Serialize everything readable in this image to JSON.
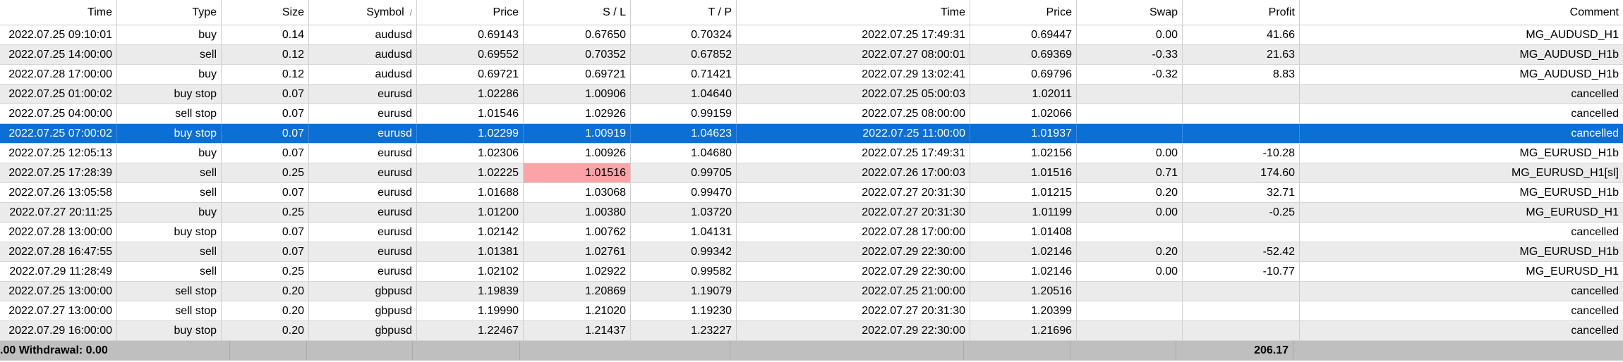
{
  "headers": [
    "Time",
    "Type",
    "Size",
    "Symbol",
    "Price",
    "S / L",
    "T / P",
    "Time",
    "Price",
    "Swap",
    "Profit",
    "Comment"
  ],
  "sort_icon": "/",
  "rows": [
    {
      "open_time": "2022.07.25 09:10:01",
      "type": "buy",
      "size": "0.14",
      "symbol": "audusd",
      "open_price": "0.69143",
      "sl": "0.67650",
      "tp": "0.70324",
      "close_time": "2022.07.25 17:49:31",
      "close_price": "0.69447",
      "swap": "0.00",
      "profit": "41.66",
      "comment": "MG_AUDUSD_H1"
    },
    {
      "open_time": "2022.07.25 14:00:00",
      "type": "sell",
      "size": "0.12",
      "symbol": "audusd",
      "open_price": "0.69552",
      "sl": "0.70352",
      "tp": "0.67852",
      "close_time": "2022.07.27 08:00:01",
      "close_price": "0.69369",
      "swap": "-0.33",
      "profit": "21.63",
      "comment": "MG_AUDUSD_H1b"
    },
    {
      "open_time": "2022.07.28 17:00:00",
      "type": "buy",
      "size": "0.12",
      "symbol": "audusd",
      "open_price": "0.69721",
      "sl": "0.69721",
      "tp": "0.71421",
      "close_time": "2022.07.29 13:02:41",
      "close_price": "0.69796",
      "swap": "-0.32",
      "profit": "8.83",
      "comment": "MG_AUDUSD_H1b"
    },
    {
      "open_time": "2022.07.25 01:00:02",
      "type": "buy stop",
      "size": "0.07",
      "symbol": "eurusd",
      "open_price": "1.02286",
      "sl": "1.00906",
      "tp": "1.04640",
      "close_time": "2022.07.25 05:00:03",
      "close_price": "1.02011",
      "swap": "",
      "profit": "",
      "comment": "cancelled"
    },
    {
      "open_time": "2022.07.25 04:00:00",
      "type": "sell stop",
      "size": "0.07",
      "symbol": "eurusd",
      "open_price": "1.01546",
      "sl": "1.02926",
      "tp": "0.99159",
      "close_time": "2022.07.25 08:00:00",
      "close_price": "1.02066",
      "swap": "",
      "profit": "",
      "comment": "cancelled"
    },
    {
      "open_time": "2022.07.25 07:00:02",
      "type": "buy stop",
      "size": "0.07",
      "symbol": "eurusd",
      "open_price": "1.02299",
      "sl": "1.00919",
      "tp": "1.04623",
      "close_time": "2022.07.25 11:00:00",
      "close_price": "1.01937",
      "swap": "",
      "profit": "",
      "comment": "cancelled"
    },
    {
      "open_time": "2022.07.25 12:05:13",
      "type": "buy",
      "size": "0.07",
      "symbol": "eurusd",
      "open_price": "1.02306",
      "sl": "1.00926",
      "tp": "1.04680",
      "close_time": "2022.07.25 17:49:31",
      "close_price": "1.02156",
      "swap": "0.00",
      "profit": "-10.28",
      "comment": "MG_EURUSD_H1b"
    },
    {
      "open_time": "2022.07.25 17:28:39",
      "type": "sell",
      "size": "0.25",
      "symbol": "eurusd",
      "open_price": "1.02225",
      "sl": "1.01516",
      "tp": "0.99705",
      "close_time": "2022.07.26 17:00:03",
      "close_price": "1.01516",
      "swap": "0.71",
      "profit": "174.60",
      "comment": "MG_EURUSD_H1[sl]"
    },
    {
      "open_time": "2022.07.26 13:05:58",
      "type": "sell",
      "size": "0.07",
      "symbol": "eurusd",
      "open_price": "1.01688",
      "sl": "1.03068",
      "tp": "0.99470",
      "close_time": "2022.07.27 20:31:30",
      "close_price": "1.01215",
      "swap": "0.20",
      "profit": "32.71",
      "comment": "MG_EURUSD_H1b"
    },
    {
      "open_time": "2022.07.27 20:11:25",
      "type": "buy",
      "size": "0.25",
      "symbol": "eurusd",
      "open_price": "1.01200",
      "sl": "1.00380",
      "tp": "1.03720",
      "close_time": "2022.07.27 20:31:30",
      "close_price": "1.01199",
      "swap": "0.00",
      "profit": "-0.25",
      "comment": "MG_EURUSD_H1"
    },
    {
      "open_time": "2022.07.28 13:00:00",
      "type": "buy stop",
      "size": "0.07",
      "symbol": "eurusd",
      "open_price": "1.02142",
      "sl": "1.00762",
      "tp": "1.04131",
      "close_time": "2022.07.28 17:00:00",
      "close_price": "1.01408",
      "swap": "",
      "profit": "",
      "comment": "cancelled"
    },
    {
      "open_time": "2022.07.28 16:47:55",
      "type": "sell",
      "size": "0.07",
      "symbol": "eurusd",
      "open_price": "1.01381",
      "sl": "1.02761",
      "tp": "0.99342",
      "close_time": "2022.07.29 22:30:00",
      "close_price": "1.02146",
      "swap": "0.20",
      "profit": "-52.42",
      "comment": "MG_EURUSD_H1b"
    },
    {
      "open_time": "2022.07.29 11:28:49",
      "type": "sell",
      "size": "0.25",
      "symbol": "eurusd",
      "open_price": "1.02102",
      "sl": "1.02922",
      "tp": "0.99582",
      "close_time": "2022.07.29 22:30:00",
      "close_price": "1.02146",
      "swap": "0.00",
      "profit": "-10.77",
      "comment": "MG_EURUSD_H1"
    },
    {
      "open_time": "2022.07.25 13:00:00",
      "type": "sell stop",
      "size": "0.20",
      "symbol": "gbpusd",
      "open_price": "1.19839",
      "sl": "1.20869",
      "tp": "1.19079",
      "close_time": "2022.07.25 21:00:00",
      "close_price": "1.20516",
      "swap": "",
      "profit": "",
      "comment": "cancelled"
    },
    {
      "open_time": "2022.07.27 13:00:00",
      "type": "sell stop",
      "size": "0.20",
      "symbol": "gbpusd",
      "open_price": "1.19990",
      "sl": "1.21020",
      "tp": "1.19230",
      "close_time": "2022.07.27 20:31:30",
      "close_price": "1.20399",
      "swap": "",
      "profit": "",
      "comment": "cancelled"
    },
    {
      "open_time": "2022.07.29 16:00:00",
      "type": "buy stop",
      "size": "0.20",
      "symbol": "gbpusd",
      "open_price": "1.22467",
      "sl": "1.21437",
      "tp": "1.23227",
      "close_time": "2022.07.29 22:30:00",
      "close_price": "1.21696",
      "swap": "",
      "profit": "",
      "comment": "cancelled"
    }
  ],
  "selected_row": 5,
  "sl_hit_row": 7,
  "footer": {
    "summary": ".00  Withdrawal: 0.00",
    "total_profit": "206.17"
  },
  "colors": {
    "selected": "#0a6fd6",
    "stripe": "#ebebeb",
    "sl_hit": "#fca3a7",
    "footer": "#bfbfbf"
  }
}
